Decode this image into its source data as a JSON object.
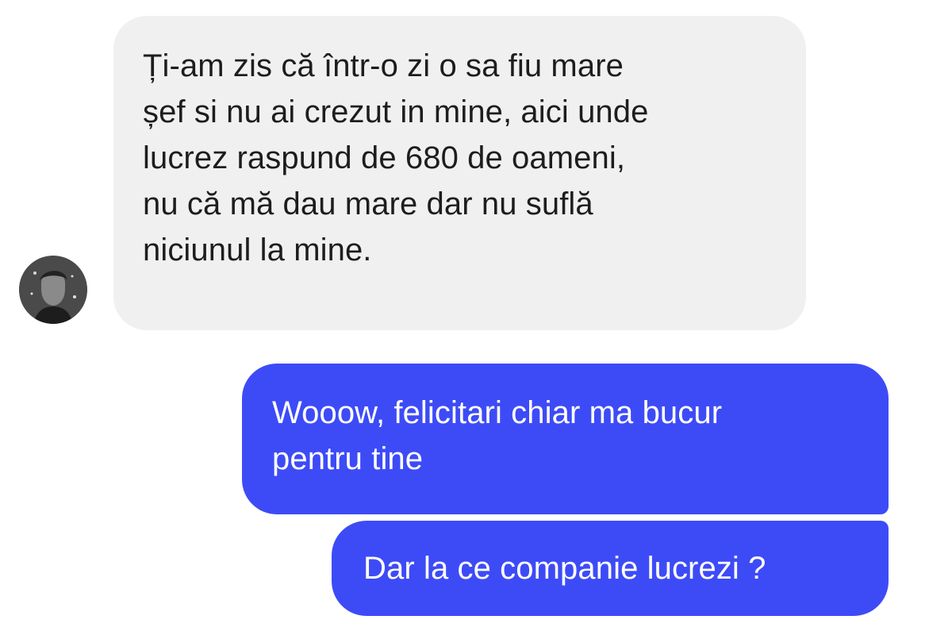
{
  "conversation": {
    "avatar_icon": "user-avatar-photo",
    "messages": [
      {
        "sender": "contact",
        "text": "Ți-am zis că într-o zi o sa fiu mare\nșef si nu ai crezut in mine, aici unde\nlucrez raspund de 680 de oameni,\nnu că mă dau mare dar nu suflă\nniciunul la mine."
      },
      {
        "sender": "me",
        "text": "Wooow, felicitari chiar ma bucur\npentru tine"
      },
      {
        "sender": "me",
        "text": "Dar la ce companie lucrezi ?"
      }
    ]
  },
  "colors": {
    "incoming_bubble": "#f0f0f0",
    "incoming_text": "#1d1d1d",
    "outgoing_bubble": "#3d4bf7",
    "outgoing_text": "#ffffff"
  }
}
